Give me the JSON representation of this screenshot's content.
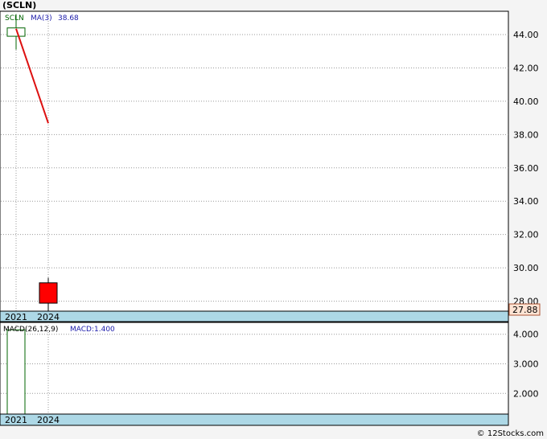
{
  "title": "(SCLN)",
  "footer": "© 12Stocks.com",
  "colors": {
    "up_candle": "#006400",
    "down_candle": "#ff0000",
    "ma_line": "#dd1111",
    "date_bar": "#add8e6",
    "price_tag_bg": "#ffe4d4",
    "label_blue": "#1a1aaa",
    "label_green": "#006400"
  },
  "chart_data": [
    {
      "type": "candlestick",
      "panel": "price",
      "legend": [
        {
          "text": "SCLN",
          "color": "green"
        },
        {
          "text": "MA(3)",
          "color": "blue"
        },
        {
          "text": "38.68",
          "color": "blue"
        }
      ],
      "x_labels": [
        "2021",
        "2024"
      ],
      "candles": [
        {
          "label": "2021",
          "open": 43.9,
          "high": 45.2,
          "low": 43.1,
          "close": 44.4
        },
        {
          "label": "2024",
          "open": 29.1,
          "high": 29.4,
          "low": 27.2,
          "close": 27.88
        }
      ],
      "ma": {
        "name": "MA(3)",
        "points": [
          {
            "label": "2021",
            "value": 44.35
          },
          {
            "label": "2024",
            "value": 38.68
          }
        ]
      },
      "y_ticks": [
        28,
        30,
        32,
        34,
        36,
        38,
        40,
        42,
        44
      ],
      "y_tick_labels": [
        "28.00",
        "30.00",
        "32.00",
        "34.00",
        "36.00",
        "38.00",
        "40.00",
        "42.00",
        "44.00"
      ],
      "ylim": [
        27.4,
        45.4
      ],
      "last_price": "27.88",
      "grid": true
    },
    {
      "type": "bar",
      "panel": "macd",
      "legend": [
        {
          "text": "MACD(26,12,9)",
          "color": "black"
        },
        {
          "text": "MACD:1.400",
          "color": "blue"
        }
      ],
      "x_labels": [
        "2021",
        "2024"
      ],
      "bars": [
        {
          "label": "2021",
          "value": 4.15
        }
      ],
      "y_ticks": [
        2,
        3,
        4
      ],
      "y_tick_labels": [
        "2.000",
        "3.000",
        "4.000"
      ],
      "ylim": [
        1.3,
        4.4
      ],
      "grid": true
    }
  ]
}
